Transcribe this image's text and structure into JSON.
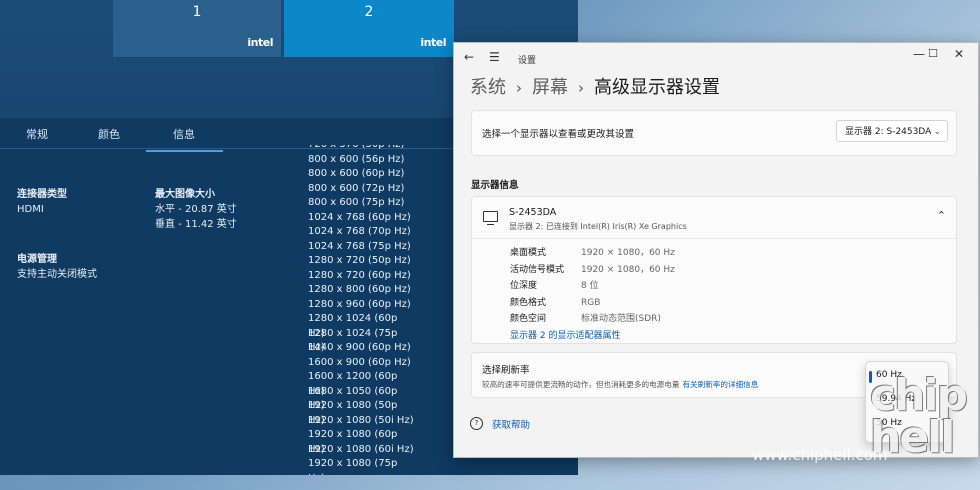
{
  "display_props": {
    "monitors": [
      {
        "number": "1",
        "brand": "intel"
      },
      {
        "number": "2",
        "brand": "intel"
      }
    ],
    "tabs": [
      "常规",
      "颜色",
      "信息"
    ],
    "connector_label": "连接器类型",
    "connector_value": "HDMI",
    "max_size_label": "最大图像大小",
    "max_size_h": "水平 - 20.87 英寸",
    "max_size_v": "垂直 - 11.42 英寸",
    "power_label": "电源管理",
    "power_value": "支持主动关闭模式",
    "modes": [
      "720 x 576 (50p Hz)",
      "800 x 600 (56p Hz)",
      "800 x 600 (60p Hz)",
      "800 x 600 (72p Hz)",
      "800 x 600 (75p Hz)",
      "1024 x 768 (60p Hz)",
      "1024 x 768 (70p Hz)",
      "1024 x 768 (75p Hz)",
      "1280 x 720 (50p Hz)",
      "1280 x 720 (60p Hz)",
      "1280 x 800 (60p Hz)",
      "1280 x 960 (60p Hz)",
      "1280 x 1024 (60p Hz)",
      "1280 x 1024 (75p Hz)",
      "1440 x 900 (60p Hz)",
      "1600 x 900 (60p Hz)",
      "1600 x 1200 (60p Hz)",
      "1680 x 1050 (60p Hz)",
      "1920 x 1080 (50p Hz)",
      "1920 x 1080 (50i Hz)",
      "1920 x 1080 (60p Hz)",
      "1920 x 1080 (60i Hz)",
      "1920 x 1080 (75p Hz)"
    ]
  },
  "settings": {
    "window_title": "设置",
    "breadcrumb": [
      "系统",
      "屏幕",
      "高级显示器设置"
    ],
    "select_label": "选择一个显示器以查看或更改其设置",
    "select_value": "显示器 2: S-2453DA",
    "section_title": "显示器信息",
    "display_name": "S-2453DA",
    "display_sub": "显示器 2: 已连接到 Intel(R) Iris(R) Xe Graphics",
    "info_rows": [
      {
        "k": "桌面模式",
        "v": "1920 × 1080，60 Hz"
      },
      {
        "k": "活动信号模式",
        "v": "1920 × 1080，60 Hz"
      },
      {
        "k": "位深度",
        "v": "8 位"
      },
      {
        "k": "颜色格式",
        "v": "RGB"
      },
      {
        "k": "颜色空间",
        "v": "标准动态范围(SDR)"
      }
    ],
    "adapter_link": "显示器 2 的显示适配器属性",
    "refresh_title": "选择刷新率",
    "refresh_sub": "较高的速率可提供更流畅的动作，但也消耗更多的电源电量",
    "refresh_link": "有关刷新率的详细信息",
    "refresh_options": [
      "60 Hz",
      "59.94 Hz",
      "50 Hz"
    ],
    "help_label": "获取帮助"
  },
  "watermark": {
    "url": "www.chiphell.com",
    "logo": "chip hell"
  }
}
